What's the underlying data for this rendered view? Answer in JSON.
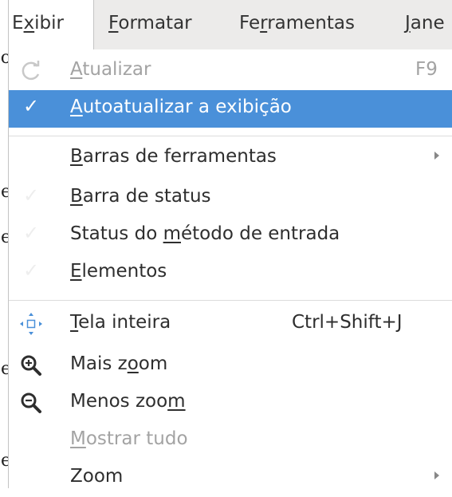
{
  "menubar": {
    "items": [
      {
        "pre": "E",
        "mn": "x",
        "post": "ibir"
      },
      {
        "pre": "",
        "mn": "F",
        "post": "ormatar"
      },
      {
        "pre": "Fe",
        "mn": "r",
        "post": "ramentas"
      },
      {
        "pre": "",
        "mn": "J",
        "post": "ane"
      }
    ]
  },
  "backdrop": [
    "o",
    "e",
    "e",
    "e",
    "e"
  ],
  "menu": {
    "refresh": {
      "pre": "",
      "mn": "A",
      "post": "tualizar",
      "accel": "F9",
      "icon": "refresh-icon"
    },
    "autorefresh": {
      "pre": "",
      "mn": "A",
      "post": "utoatualizar a exibição",
      "check": "✓"
    },
    "toolbars": {
      "pre": "",
      "mn": "B",
      "post": "arras de ferramentas"
    },
    "statusbar": {
      "pre": "",
      "mn": "B",
      "post": "arra de status"
    },
    "input_method_status": {
      "pre": "Status do ",
      "mn": "m",
      "post": "étodo de entrada"
    },
    "elements": {
      "pre": "",
      "mn": "E",
      "post": "lementos"
    },
    "fullscreen": {
      "pre": "",
      "mn": "T",
      "post": "ela inteira",
      "accel": "Ctrl+Shift+J",
      "icon": "fullscreen-icon"
    },
    "zoom_in": {
      "pre": "Mais z",
      "mn": "o",
      "post": "om",
      "icon": "zoom-in-icon"
    },
    "zoom_out": {
      "pre": "Menos zoo",
      "mn": "m",
      "post": "",
      "icon": "zoom-out-icon"
    },
    "show_all": {
      "pre": "",
      "mn": "M",
      "post": "ostrar tudo"
    },
    "zoom": {
      "pre": "Zoom",
      "mn": "",
      "post": ""
    },
    "check_glyph": "✓"
  },
  "colors": {
    "selection": "#4a90d9",
    "menubar_bg": "#ecebea",
    "disabled_text": "#a3a3a3"
  }
}
